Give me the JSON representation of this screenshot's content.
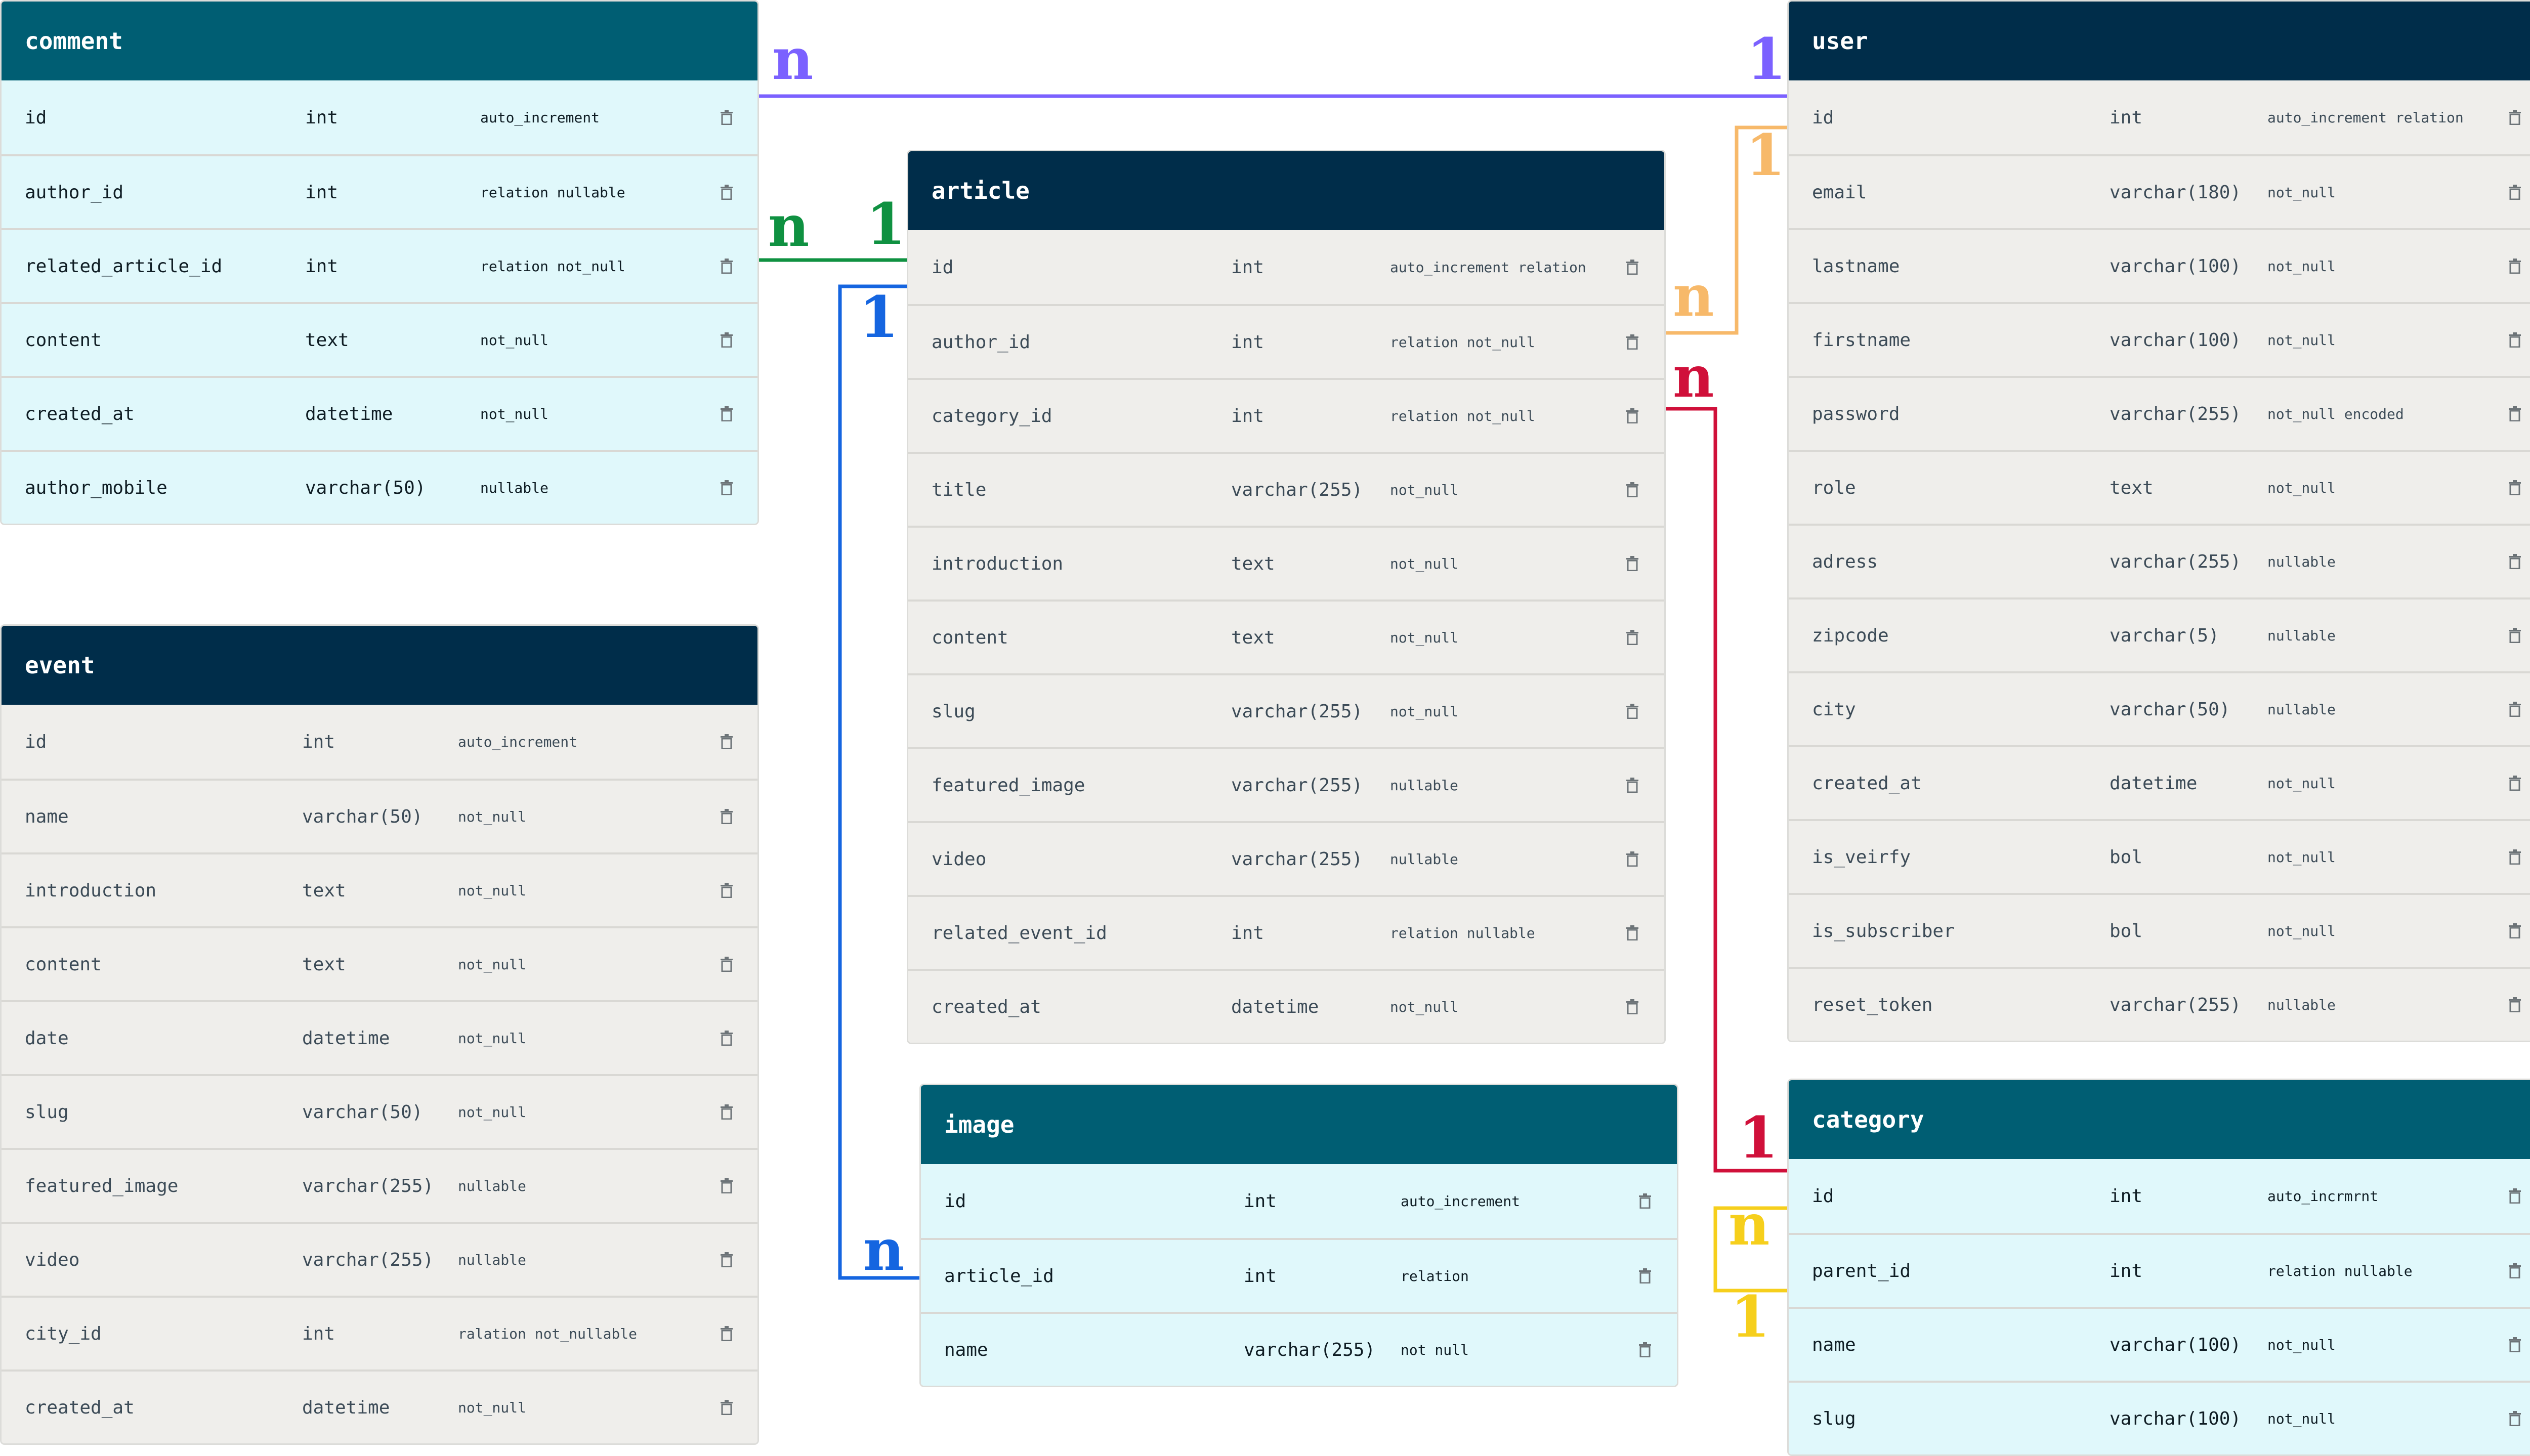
{
  "tables": {
    "comment": {
      "title": "comment",
      "rows": [
        {
          "name": "id",
          "type": "int",
          "attrs": "auto_increment"
        },
        {
          "name": "author_id",
          "type": "int",
          "attrs": "relation nullable"
        },
        {
          "name": "related_article_id",
          "type": "int",
          "attrs": "relation not_null"
        },
        {
          "name": "content",
          "type": "text",
          "attrs": "not_null"
        },
        {
          "name": "created_at",
          "type": "datetime",
          "attrs": "not_null"
        },
        {
          "name": "author_mobile",
          "type": "varchar(50)",
          "attrs": "nullable"
        }
      ]
    },
    "event": {
      "title": "event",
      "rows": [
        {
          "name": "id",
          "type": "int",
          "attrs": "auto_increment"
        },
        {
          "name": "name",
          "type": "varchar(50)",
          "attrs": "not_null"
        },
        {
          "name": "introduction",
          "type": "text",
          "attrs": "not_null"
        },
        {
          "name": "content",
          "type": "text",
          "attrs": "not_null"
        },
        {
          "name": "date",
          "type": "datetime",
          "attrs": "not_null"
        },
        {
          "name": "slug",
          "type": "varchar(50)",
          "attrs": "not_null"
        },
        {
          "name": "featured_image",
          "type": "varchar(255)",
          "attrs": "nullable"
        },
        {
          "name": "video",
          "type": "varchar(255)",
          "attrs": "nullable"
        },
        {
          "name": "city_id",
          "type": "int",
          "attrs": "ralation not_nullable"
        },
        {
          "name": "created_at",
          "type": "datetime",
          "attrs": "not_null"
        }
      ]
    },
    "article": {
      "title": "article",
      "rows": [
        {
          "name": "id",
          "type": "int",
          "attrs": "auto_increment relation"
        },
        {
          "name": "author_id",
          "type": "int",
          "attrs": "relation not_null"
        },
        {
          "name": "category_id",
          "type": "int",
          "attrs": "relation not_null"
        },
        {
          "name": "title",
          "type": "varchar(255)",
          "attrs": "not_null"
        },
        {
          "name": "introduction",
          "type": "text",
          "attrs": "not_null"
        },
        {
          "name": "content",
          "type": "text",
          "attrs": "not_null"
        },
        {
          "name": "slug",
          "type": "varchar(255)",
          "attrs": "not_null"
        },
        {
          "name": "featured_image",
          "type": "varchar(255)",
          "attrs": "nullable"
        },
        {
          "name": "video",
          "type": "varchar(255)",
          "attrs": "nullable"
        },
        {
          "name": "related_event_id",
          "type": "int",
          "attrs": "relation nullable"
        },
        {
          "name": "created_at",
          "type": "datetime",
          "attrs": "not_null"
        }
      ]
    },
    "image": {
      "title": "image",
      "rows": [
        {
          "name": "id",
          "type": "int",
          "attrs": "auto_increment"
        },
        {
          "name": "article_id",
          "type": "int",
          "attrs": "relation"
        },
        {
          "name": "name",
          "type": "varchar(255)",
          "attrs": "not null"
        }
      ]
    },
    "user": {
      "title": "user",
      "rows": [
        {
          "name": "id",
          "type": "int",
          "attrs": "auto_increment relation"
        },
        {
          "name": "email",
          "type": "varchar(180)",
          "attrs": "not_null"
        },
        {
          "name": "lastname",
          "type": "varchar(100)",
          "attrs": "not_null"
        },
        {
          "name": "firstname",
          "type": "varchar(100)",
          "attrs": "not_null"
        },
        {
          "name": "password",
          "type": "varchar(255)",
          "attrs": "not_null encoded"
        },
        {
          "name": "role",
          "type": "text",
          "attrs": "not_null"
        },
        {
          "name": "adress",
          "type": "varchar(255)",
          "attrs": "nullable"
        },
        {
          "name": "zipcode",
          "type": "varchar(5)",
          "attrs": "nullable"
        },
        {
          "name": "city",
          "type": "varchar(50)",
          "attrs": "nullable"
        },
        {
          "name": "created_at",
          "type": "datetime",
          "attrs": "not_null"
        },
        {
          "name": "is_veirfy",
          "type": "bol",
          "attrs": "not_null"
        },
        {
          "name": "is_subscriber",
          "type": "bol",
          "attrs": "not_null"
        },
        {
          "name": "reset_token",
          "type": "varchar(255)",
          "attrs": "nullable"
        }
      ]
    },
    "category": {
      "title": "category",
      "rows": [
        {
          "name": "id",
          "type": "int",
          "attrs": "auto_incrmrnt"
        },
        {
          "name": "parent_id",
          "type": "int",
          "attrs": "relation nullable"
        },
        {
          "name": "name",
          "type": "varchar(100)",
          "attrs": "not_null"
        },
        {
          "name": "slug",
          "type": "varchar(100)",
          "attrs": "not_null"
        }
      ]
    }
  },
  "relations": [
    {
      "id": "comment-user",
      "color": "#7b61ff",
      "from_card": "n",
      "to_card": "1"
    },
    {
      "id": "comment-article",
      "color": "#0f9141",
      "from_card": "n",
      "to_card": "1"
    },
    {
      "id": "article-image",
      "color": "#1565e0",
      "from_card": "1",
      "to_card": "n"
    },
    {
      "id": "article-user",
      "color": "#f7b96a",
      "from_card": "n",
      "to_card": "1"
    },
    {
      "id": "article-category",
      "color": "#d0103a",
      "from_card": "n",
      "to_card": "1"
    },
    {
      "id": "category-self",
      "color": "#f6cf1c",
      "from_card": "n",
      "to_card": "1"
    }
  ],
  "icons": {
    "delete": "trash-icon"
  }
}
